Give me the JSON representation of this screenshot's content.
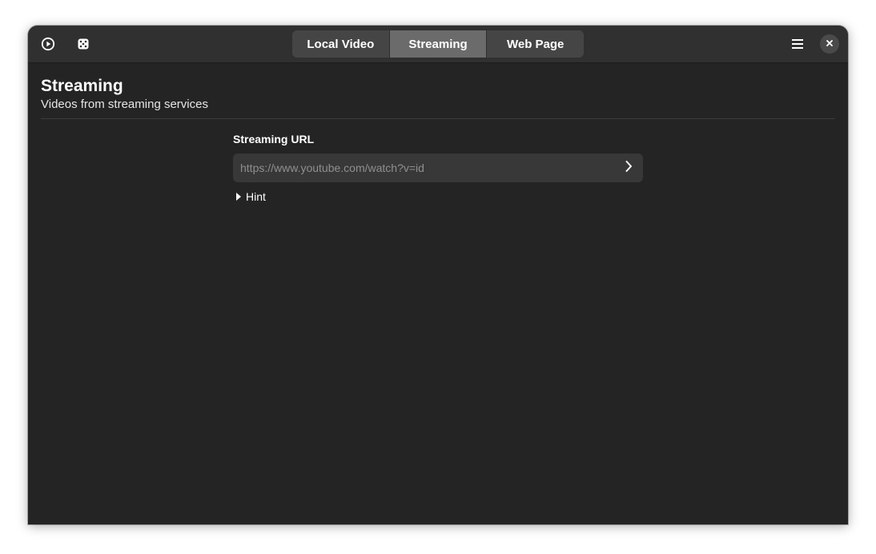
{
  "headerbar": {
    "left_icons": [
      "play-circle-icon",
      "dice-icon"
    ],
    "tabs": [
      {
        "label": "Local Video",
        "active": false
      },
      {
        "label": "Streaming",
        "active": true
      },
      {
        "label": "Web Page",
        "active": false
      }
    ],
    "right_icons": [
      "hamburger-menu-icon",
      "close-icon"
    ]
  },
  "page": {
    "title": "Streaming",
    "subtitle": "Videos from streaming services"
  },
  "form": {
    "label": "Streaming URL",
    "url_value": "",
    "url_placeholder": "https://www.youtube.com/watch?v=id",
    "go_icon": "chevron-right-icon",
    "hint_label": "Hint",
    "hint_expanded": false
  },
  "colors": {
    "window_bg": "#242424",
    "headerbar_bg": "#303030",
    "active_tab": "#6b6b6b",
    "entry_bg": "#383838"
  }
}
